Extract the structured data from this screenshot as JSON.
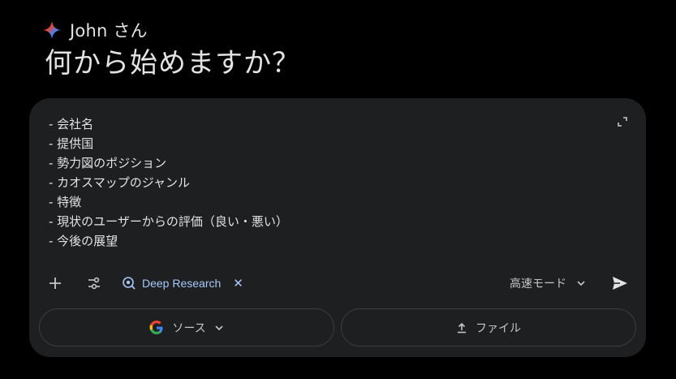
{
  "greeting": {
    "name": "John さん",
    "headline": "何から始めますか？"
  },
  "prompt": {
    "lines": [
      "- 会社名",
      "- 提供国",
      "- 勢力図のポジション",
      "- カオスマップのジャンル",
      "- 特徴",
      "- 現状のユーザーからの評価（良い・悪い）",
      "- 今後の展望"
    ]
  },
  "toolbar": {
    "plus_icon": "plus-icon",
    "tools_icon": "tools-sliders-icon",
    "chip_label": "Deep Research",
    "chip_icon": "deep-research-icon",
    "mode_label": "高速モード",
    "send_icon": "send-icon"
  },
  "bottom": {
    "source_label": "ソース",
    "file_label": "ファイル"
  },
  "colors": {
    "background": "#000000",
    "composer": "#1e1f20",
    "chip_text": "#a8c7fa",
    "text": "#e3e3e3"
  }
}
